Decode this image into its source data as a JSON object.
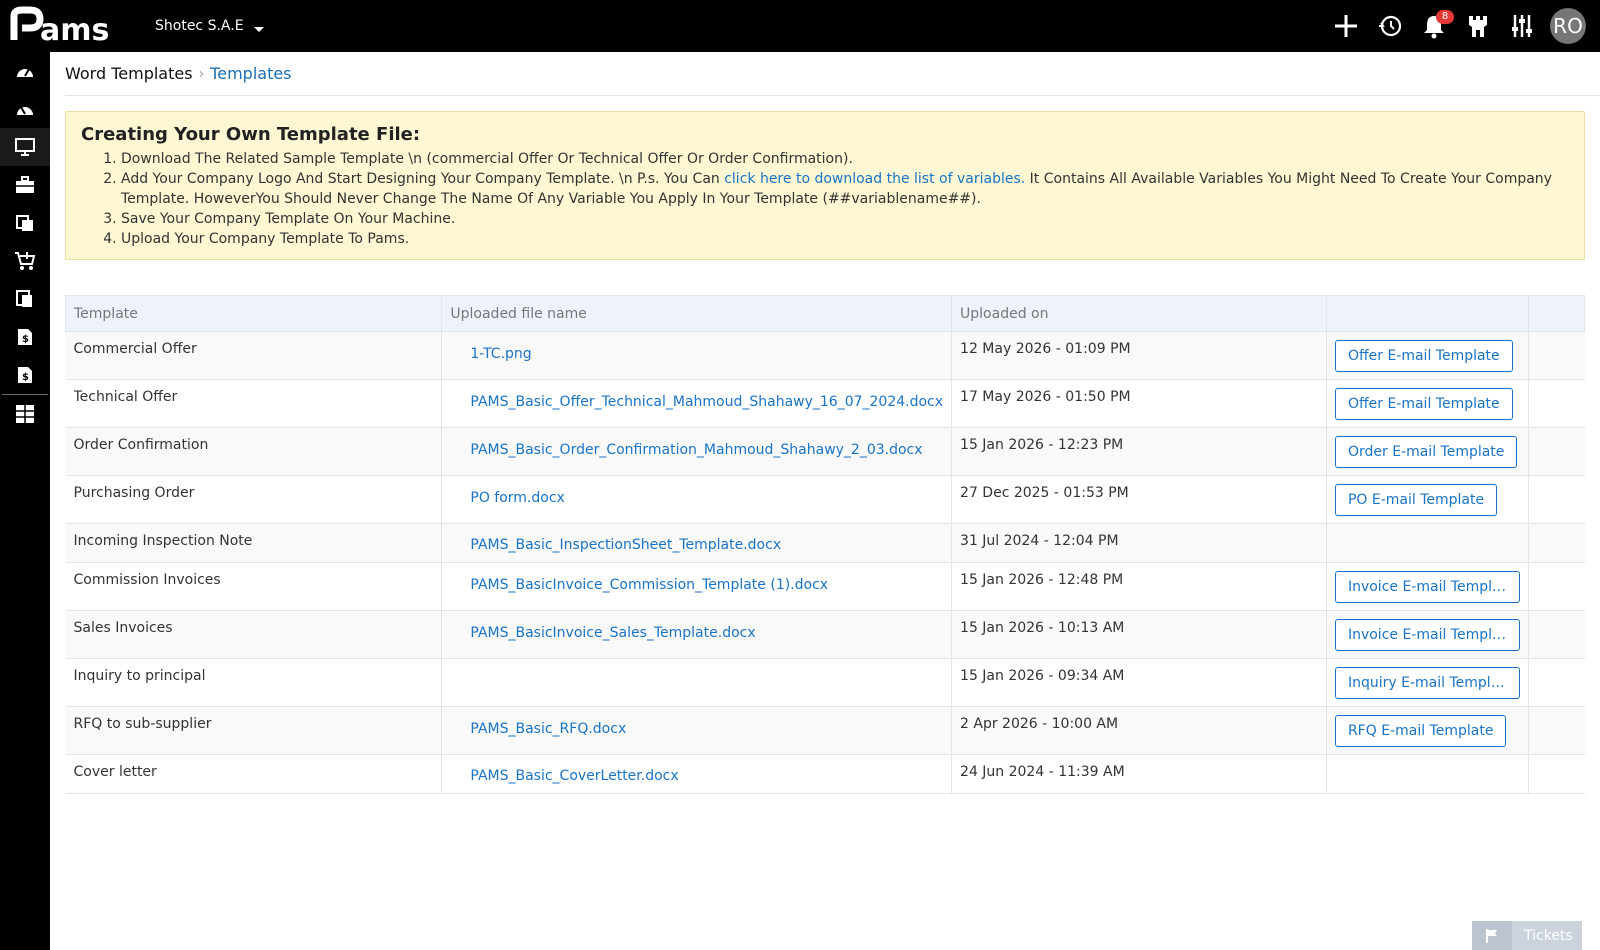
{
  "header": {
    "logo_text": "Pams",
    "company": "Shotec S.A.E",
    "notification_count": "8",
    "avatar_initials": "RO",
    "icons": [
      "plus-icon",
      "history-icon",
      "bell-icon",
      "castle-icon",
      "sliders-icon"
    ]
  },
  "sidebar": {
    "items": [
      "dashboard-icon",
      "dashboard-alt-icon",
      "monitor-icon",
      "briefcase-icon",
      "documents-icon",
      "cart-icon",
      "copy-icon",
      "invoice-icon",
      "invoice-alt-icon",
      "layout-icon"
    ]
  },
  "breadcrumb": {
    "parent": "Word Templates",
    "current": "Templates"
  },
  "info": {
    "title": "Creating Your Own Template File:",
    "step1": "Download The Related Sample Template \\n (commercial Offer Or Technical Offer Or Order Confirmation).",
    "step2_before": "Add Your Company Logo And Start Designing Your Company Template. \\n P.s. You Can ",
    "step2_link": "click here to download the list of variables.",
    "step2_after": " It Contains All Available Variables You Might Need To Create Your Company Template. HoweverYou Should Never Change The Name Of Any Variable You Apply In Your Template (##variablename##).",
    "step3": "Save Your Company Template On Your Machine.",
    "step4": "Upload Your Company Template To Pams."
  },
  "table": {
    "headers": [
      "Template",
      "Uploaded file name",
      "Uploaded on",
      "",
      ""
    ],
    "rows": [
      {
        "template": "Commercial Offer",
        "file": "1-TC.png",
        "date": "12 May 2026 - 01:09 PM",
        "button": "Offer E-mail Template"
      },
      {
        "template": "Technical Offer",
        "file": "PAMS_Basic_Offer_Technical_Mahmoud_Shahawy_16_07_2024.docx",
        "date": "17 May 2026 - 01:50 PM",
        "button": "Offer E-mail Template"
      },
      {
        "template": "Order Confirmation",
        "file": "PAMS_Basic_Order_Confirmation_Mahmoud_Shahawy_2_03.docx",
        "date": "15 Jan 2026 - 12:23 PM",
        "button": "Order E-mail Template"
      },
      {
        "template": "Purchasing Order",
        "file": "PO form.docx",
        "date": "27 Dec 2025 - 01:53 PM",
        "button": "PO E-mail Template"
      },
      {
        "template": "Incoming Inspection Note",
        "file": "PAMS_Basic_InspectionSheet_Template.docx",
        "date": "31 Jul 2024 - 12:04 PM",
        "button": ""
      },
      {
        "template": "Commission Invoices",
        "file": "PAMS_BasicInvoice_Commission_Template (1).docx",
        "date": "15 Jan 2026 - 12:48 PM",
        "button": "Invoice E-mail Template"
      },
      {
        "template": "Sales Invoices",
        "file": "PAMS_BasicInvoice_Sales_Template.docx",
        "date": "15 Jan 2026 - 10:13 AM",
        "button": "Invoice E-mail Template"
      },
      {
        "template": "Inquiry to principal",
        "file": "",
        "date": "15 Jan 2026 - 09:34 AM",
        "button": "Inquiry E-mail Template"
      },
      {
        "template": "RFQ to sub-supplier",
        "file": "PAMS_Basic_RFQ.docx",
        "date": "2 Apr 2026 - 10:00 AM",
        "button": "RFQ E-mail Template"
      },
      {
        "template": "Cover letter",
        "file": "PAMS_Basic_CoverLetter.docx",
        "date": "24 Jun 2024 - 11:39 AM",
        "button": ""
      }
    ]
  },
  "tickets": {
    "label": "Tickets"
  },
  "colors": {
    "accent": "#1a73c5",
    "topbar": "#000000",
    "info_bg": "#fdf8d3",
    "badge": "#e53935"
  }
}
